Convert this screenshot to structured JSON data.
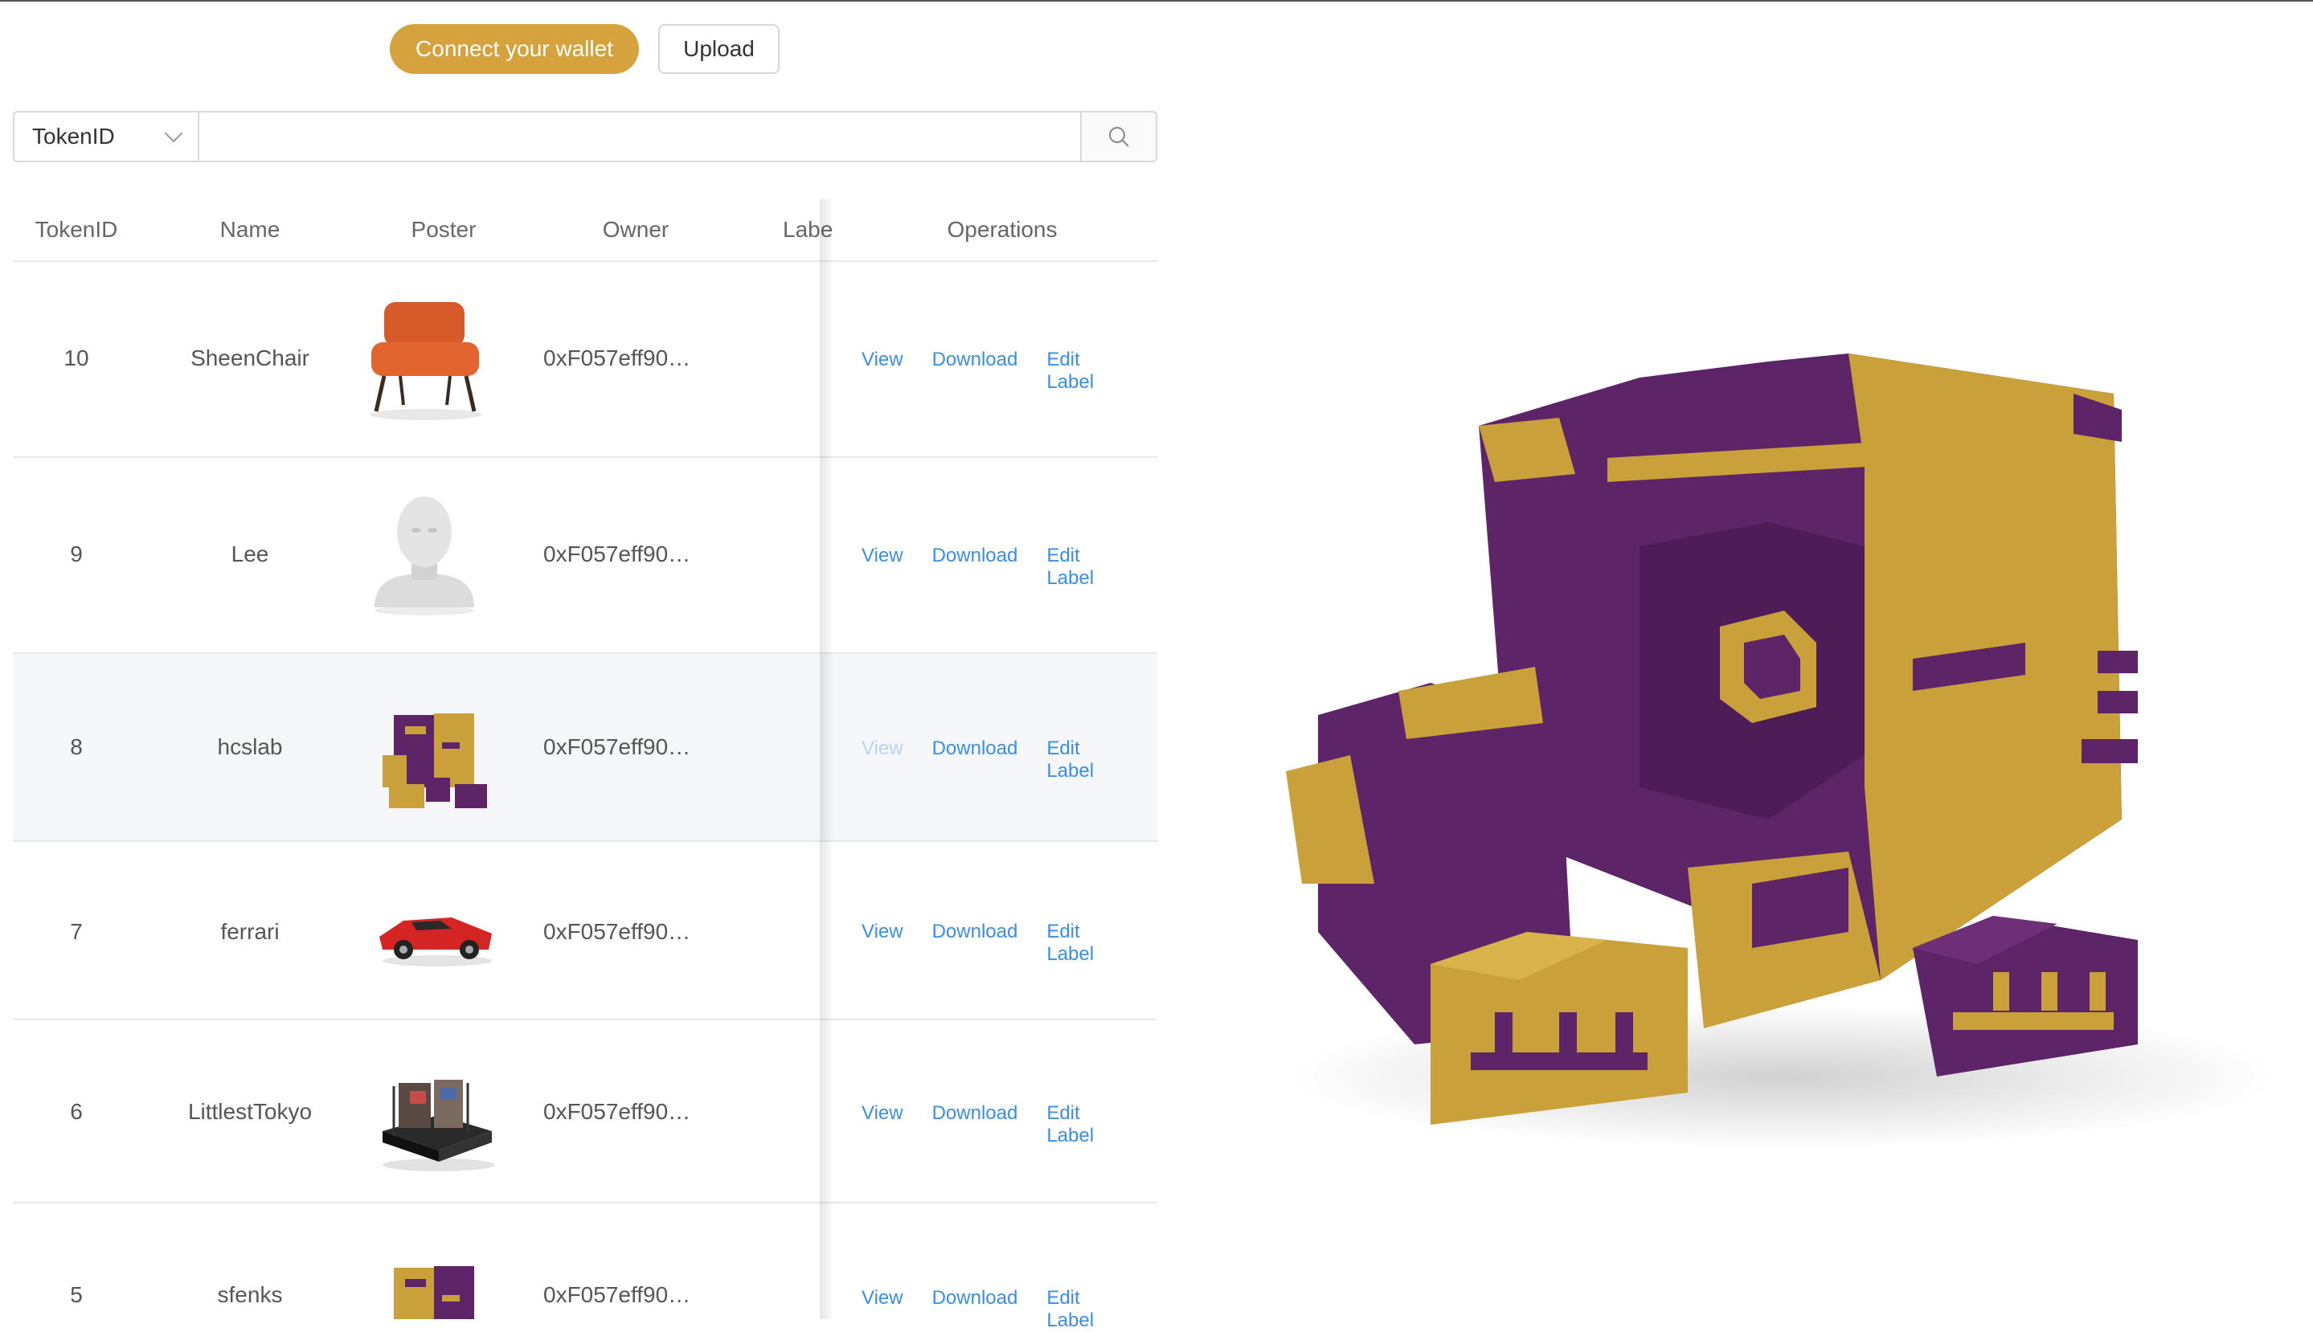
{
  "header": {
    "connect_label": "Connect your wallet",
    "upload_label": "Upload"
  },
  "search": {
    "field": "TokenID",
    "value": ""
  },
  "table": {
    "columns": [
      "TokenID",
      "Name",
      "Poster",
      "Owner",
      "Labe",
      "Operations"
    ],
    "rows": [
      {
        "token_id": "10",
        "name": "SheenChair",
        "poster": "chair",
        "owner": "0xF057eff90…",
        "ops": [
          "View",
          "Download",
          "Edit Label"
        ]
      },
      {
        "token_id": "9",
        "name": "Lee",
        "poster": "head-bust",
        "owner": "0xF057eff90…",
        "ops": [
          "View",
          "Download",
          "Edit Label"
        ]
      },
      {
        "token_id": "8",
        "name": "hcslab",
        "poster": "voxel-sphinx",
        "owner": "0xF057eff90…",
        "ops": [
          "View",
          "Download",
          "Edit Label"
        ]
      },
      {
        "token_id": "7",
        "name": "ferrari",
        "poster": "red-car",
        "owner": "0xF057eff90…",
        "ops": [
          "View",
          "Download",
          "Edit Label"
        ]
      },
      {
        "token_id": "6",
        "name": "LittlestTokyo",
        "poster": "tokyo-diorama",
        "owner": "0xF057eff90…",
        "ops": [
          "View",
          "Download",
          "Edit Label"
        ]
      },
      {
        "token_id": "5",
        "name": "sfenks",
        "poster": "voxel-sphinx",
        "owner": "0xF057eff90…",
        "ops": [
          "View",
          "Download",
          "Edit Label"
        ]
      }
    ]
  },
  "viewer": {
    "model": "voxel-sphinx"
  },
  "colors": {
    "accent": "#d6a23d",
    "link": "#3a8ee6",
    "voxel_purple": "#5e2468",
    "voxel_gold": "#c9a03a"
  }
}
